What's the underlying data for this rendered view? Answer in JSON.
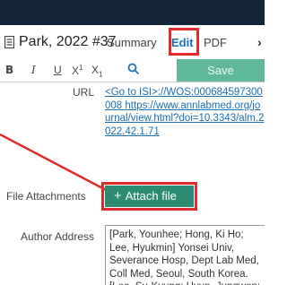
{
  "header": {
    "ref_title": "Park, 2022 #37",
    "tabs": {
      "summary": "Summary",
      "edit": "Edit",
      "pdf": "PDF"
    },
    "more": "›"
  },
  "toolbar": {
    "bold": "B",
    "italic": "I",
    "underline": "U",
    "superscript_base": "X",
    "superscript": "1",
    "subscript_base": "X",
    "subscript": "1",
    "save_label": "Save"
  },
  "fields": {
    "url": {
      "label": "URL",
      "value": "<Go to ISI>://WOS:000684597300008 https://www.annlabmed.org/journal/view.html?doi=10.3343/alm.2022.42.1.71"
    },
    "file_attachments": {
      "label": "File Attachments",
      "button": "Attach file"
    },
    "author_address": {
      "label": "Author Address",
      "value": "[Park, Younhee; Hong, Ki Ho; Lee, Hyukmin] Yonsei Univ, Severance Hosp, Dept Lab Med, Coll Med, Seoul, South Korea. [Lee, Su-Kyung; Hyun, Jungwon; Kim, Hyun Soo] Hallym Univ, Coll Med, Dept Lab Med, Dongtan Sacred Heart"
    }
  },
  "colors": {
    "topbar": "#13233a",
    "link": "#1a6fb5",
    "save": "#5fb89c",
    "attach": "#2b8a72",
    "highlight": "#e02b2b"
  }
}
